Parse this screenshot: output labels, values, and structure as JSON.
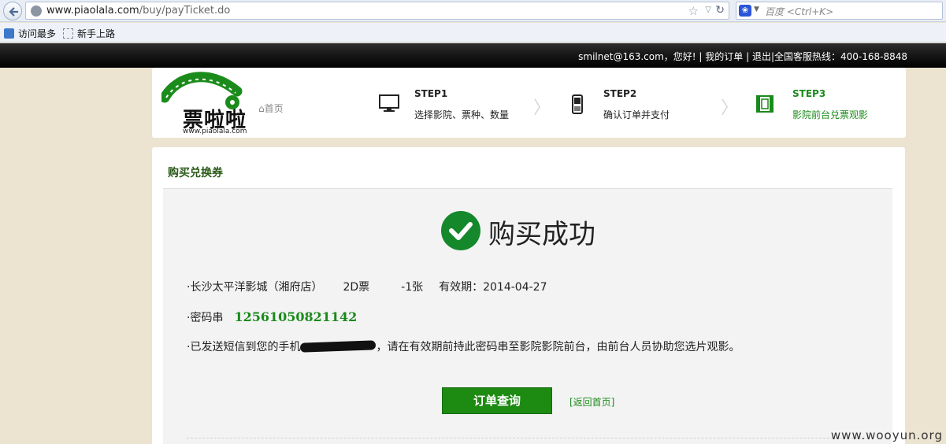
{
  "browser": {
    "url_host": "www.piaolala.com",
    "url_path": "/buy/payTicket.do",
    "search_placeholder": "百度 <Ctrl+K>",
    "bookmarks": [
      {
        "label": "访问最多"
      },
      {
        "label": "新手上路"
      }
    ]
  },
  "topbar": {
    "text": "smilnet@163.com，您好! | 我的订单 | 退出|全国客服热线：400-168-8848"
  },
  "header": {
    "logo_text": "票啦啦",
    "logo_domain": "www.piaolala.com",
    "home_label": "首页",
    "steps": [
      {
        "title": "STEP1",
        "desc": "选择影院、票种、数量"
      },
      {
        "title": "STEP2",
        "desc": "确认订单并支付"
      },
      {
        "title": "STEP3",
        "desc": "影院前台兑票观影"
      }
    ],
    "arrow": "〉"
  },
  "main": {
    "section_title": "购买兑换券",
    "success_text": "购买成功",
    "cinema": "·长沙太平洋影城（湘府店）",
    "ticket_type": "2D票",
    "count": "-1张",
    "validity": "有效期：2014-04-27",
    "code_label": "·密码串",
    "code": "12561050821142",
    "sms_prefix": "·已发送短信到您的手机",
    "sms_suffix": "，请在有效期前持此密码串至影院影院前台，由前台人员协助您选片观影。",
    "order_button": "订单查询",
    "back_home": "[返回首页]"
  },
  "watermark": "www.wooyun.org",
  "colors": {
    "accent_green": "#1d8a12",
    "background": "#ece3d0"
  }
}
